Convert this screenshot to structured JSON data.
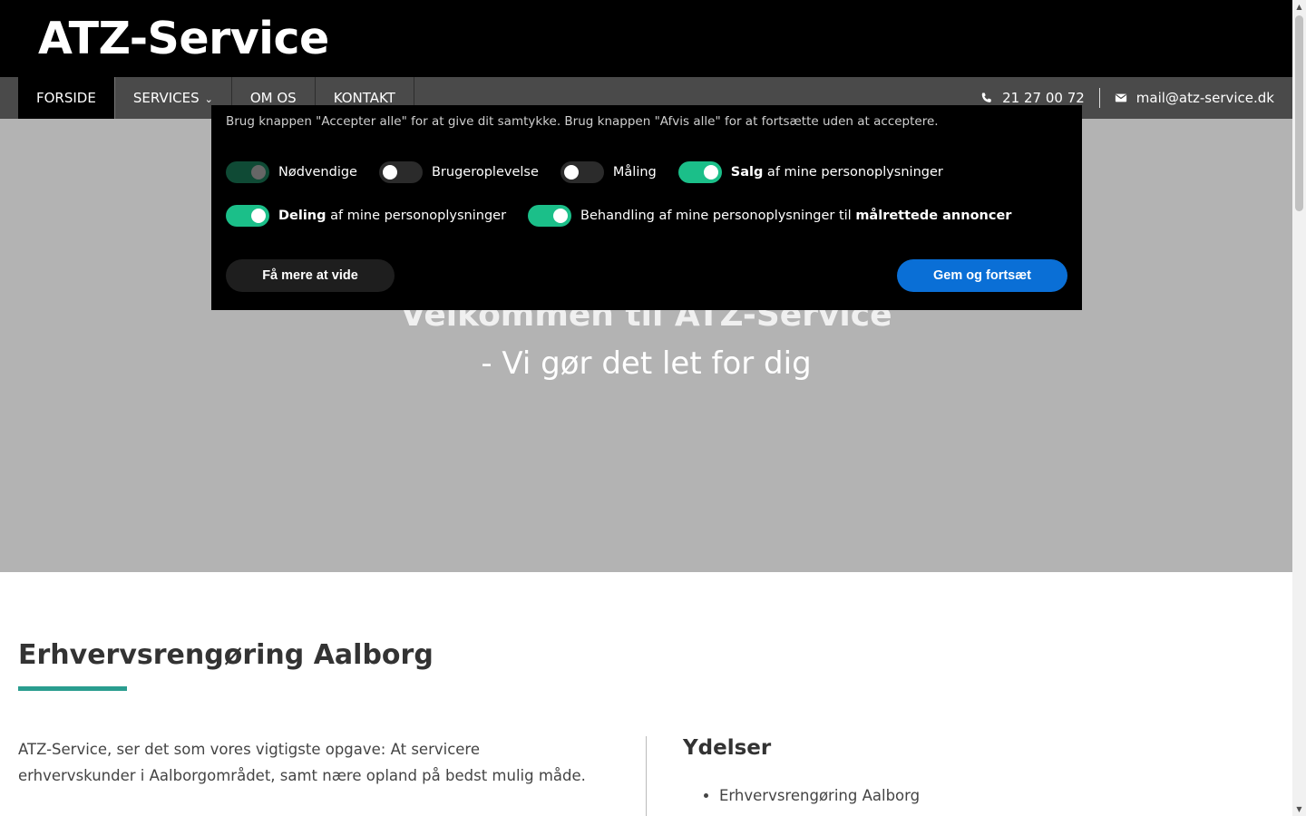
{
  "header": {
    "brand": "ATZ-Service"
  },
  "nav": {
    "items": [
      {
        "label": "FORSIDE",
        "active": true
      },
      {
        "label": "SERVICES",
        "has_dropdown": true
      },
      {
        "label": "OM OS"
      },
      {
        "label": "KONTAKT"
      }
    ],
    "phone": "21 27 00 72",
    "email": "mail@atz-service.dk"
  },
  "hero": {
    "title": "Velkommen til ATZ-Service",
    "subtitle": "- Vi gør det let for dig"
  },
  "consent": {
    "text": "Brug knappen \"Accepter alle\" for at give dit samtykke. Brug knappen \"Afvis alle\" for at fortsætte uden at acceptere.",
    "toggles": [
      {
        "label": "Nødvendige",
        "state": "locked-on"
      },
      {
        "label": "Brugeroplevelse",
        "state": "off"
      },
      {
        "label": "Måling",
        "state": "off"
      },
      {
        "bold": "Salg",
        "rest": " af mine personoplysninger",
        "state": "on"
      },
      {
        "bold": "Deling",
        "rest": " af mine personoplysninger",
        "state": "on"
      },
      {
        "prefix": "Behandling af mine personoplysninger til ",
        "bold": "målrettede annoncer",
        "state": "on"
      }
    ],
    "learn_more": "Få mere at vide",
    "save": "Gem og fortsæt"
  },
  "content": {
    "section_title": "Erhvervsrengøring Aalborg",
    "intro": "ATZ-Service, ser det som vores vigtigste opgave: At servicere erhvervskunder i Aalborgområdet, samt nære opland på bedst mulig måde.",
    "ydelser_title": "Ydelser",
    "ydelser": [
      "Erhvervsrengøring Aalborg"
    ]
  },
  "colors": {
    "accent": "#2a9d8f",
    "toggle_on": "#1bbf89",
    "save_button": "#0a6fd6"
  }
}
